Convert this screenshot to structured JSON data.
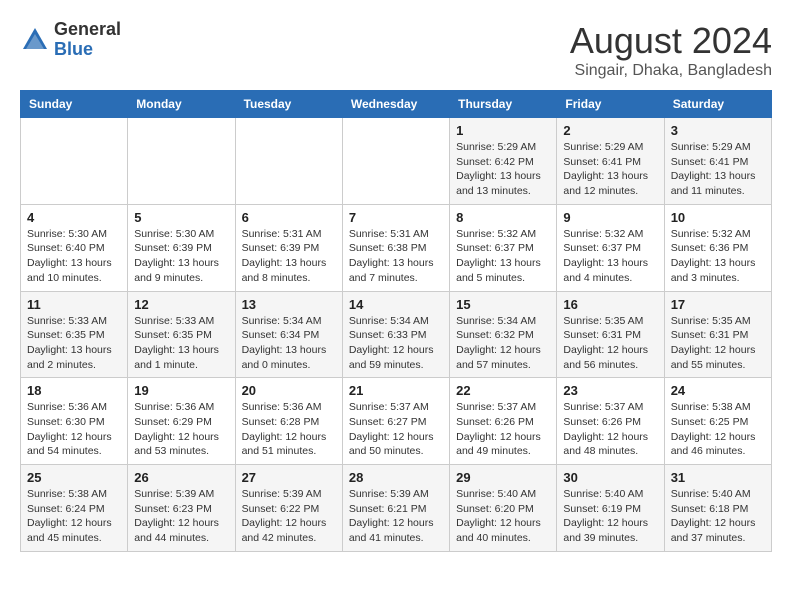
{
  "header": {
    "logo_general": "General",
    "logo_blue": "Blue",
    "month_title": "August 2024",
    "location": "Singair, Dhaka, Bangladesh"
  },
  "weekdays": [
    "Sunday",
    "Monday",
    "Tuesday",
    "Wednesday",
    "Thursday",
    "Friday",
    "Saturday"
  ],
  "weeks": [
    [
      {
        "day": "",
        "detail": ""
      },
      {
        "day": "",
        "detail": ""
      },
      {
        "day": "",
        "detail": ""
      },
      {
        "day": "",
        "detail": ""
      },
      {
        "day": "1",
        "detail": "Sunrise: 5:29 AM\nSunset: 6:42 PM\nDaylight: 13 hours\nand 13 minutes."
      },
      {
        "day": "2",
        "detail": "Sunrise: 5:29 AM\nSunset: 6:41 PM\nDaylight: 13 hours\nand 12 minutes."
      },
      {
        "day": "3",
        "detail": "Sunrise: 5:29 AM\nSunset: 6:41 PM\nDaylight: 13 hours\nand 11 minutes."
      }
    ],
    [
      {
        "day": "4",
        "detail": "Sunrise: 5:30 AM\nSunset: 6:40 PM\nDaylight: 13 hours\nand 10 minutes."
      },
      {
        "day": "5",
        "detail": "Sunrise: 5:30 AM\nSunset: 6:39 PM\nDaylight: 13 hours\nand 9 minutes."
      },
      {
        "day": "6",
        "detail": "Sunrise: 5:31 AM\nSunset: 6:39 PM\nDaylight: 13 hours\nand 8 minutes."
      },
      {
        "day": "7",
        "detail": "Sunrise: 5:31 AM\nSunset: 6:38 PM\nDaylight: 13 hours\nand 7 minutes."
      },
      {
        "day": "8",
        "detail": "Sunrise: 5:32 AM\nSunset: 6:37 PM\nDaylight: 13 hours\nand 5 minutes."
      },
      {
        "day": "9",
        "detail": "Sunrise: 5:32 AM\nSunset: 6:37 PM\nDaylight: 13 hours\nand 4 minutes."
      },
      {
        "day": "10",
        "detail": "Sunrise: 5:32 AM\nSunset: 6:36 PM\nDaylight: 13 hours\nand 3 minutes."
      }
    ],
    [
      {
        "day": "11",
        "detail": "Sunrise: 5:33 AM\nSunset: 6:35 PM\nDaylight: 13 hours\nand 2 minutes."
      },
      {
        "day": "12",
        "detail": "Sunrise: 5:33 AM\nSunset: 6:35 PM\nDaylight: 13 hours\nand 1 minute."
      },
      {
        "day": "13",
        "detail": "Sunrise: 5:34 AM\nSunset: 6:34 PM\nDaylight: 13 hours\nand 0 minutes."
      },
      {
        "day": "14",
        "detail": "Sunrise: 5:34 AM\nSunset: 6:33 PM\nDaylight: 12 hours\nand 59 minutes."
      },
      {
        "day": "15",
        "detail": "Sunrise: 5:34 AM\nSunset: 6:32 PM\nDaylight: 12 hours\nand 57 minutes."
      },
      {
        "day": "16",
        "detail": "Sunrise: 5:35 AM\nSunset: 6:31 PM\nDaylight: 12 hours\nand 56 minutes."
      },
      {
        "day": "17",
        "detail": "Sunrise: 5:35 AM\nSunset: 6:31 PM\nDaylight: 12 hours\nand 55 minutes."
      }
    ],
    [
      {
        "day": "18",
        "detail": "Sunrise: 5:36 AM\nSunset: 6:30 PM\nDaylight: 12 hours\nand 54 minutes."
      },
      {
        "day": "19",
        "detail": "Sunrise: 5:36 AM\nSunset: 6:29 PM\nDaylight: 12 hours\nand 53 minutes."
      },
      {
        "day": "20",
        "detail": "Sunrise: 5:36 AM\nSunset: 6:28 PM\nDaylight: 12 hours\nand 51 minutes."
      },
      {
        "day": "21",
        "detail": "Sunrise: 5:37 AM\nSunset: 6:27 PM\nDaylight: 12 hours\nand 50 minutes."
      },
      {
        "day": "22",
        "detail": "Sunrise: 5:37 AM\nSunset: 6:26 PM\nDaylight: 12 hours\nand 49 minutes."
      },
      {
        "day": "23",
        "detail": "Sunrise: 5:37 AM\nSunset: 6:26 PM\nDaylight: 12 hours\nand 48 minutes."
      },
      {
        "day": "24",
        "detail": "Sunrise: 5:38 AM\nSunset: 6:25 PM\nDaylight: 12 hours\nand 46 minutes."
      }
    ],
    [
      {
        "day": "25",
        "detail": "Sunrise: 5:38 AM\nSunset: 6:24 PM\nDaylight: 12 hours\nand 45 minutes."
      },
      {
        "day": "26",
        "detail": "Sunrise: 5:39 AM\nSunset: 6:23 PM\nDaylight: 12 hours\nand 44 minutes."
      },
      {
        "day": "27",
        "detail": "Sunrise: 5:39 AM\nSunset: 6:22 PM\nDaylight: 12 hours\nand 42 minutes."
      },
      {
        "day": "28",
        "detail": "Sunrise: 5:39 AM\nSunset: 6:21 PM\nDaylight: 12 hours\nand 41 minutes."
      },
      {
        "day": "29",
        "detail": "Sunrise: 5:40 AM\nSunset: 6:20 PM\nDaylight: 12 hours\nand 40 minutes."
      },
      {
        "day": "30",
        "detail": "Sunrise: 5:40 AM\nSunset: 6:19 PM\nDaylight: 12 hours\nand 39 minutes."
      },
      {
        "day": "31",
        "detail": "Sunrise: 5:40 AM\nSunset: 6:18 PM\nDaylight: 12 hours\nand 37 minutes."
      }
    ]
  ]
}
